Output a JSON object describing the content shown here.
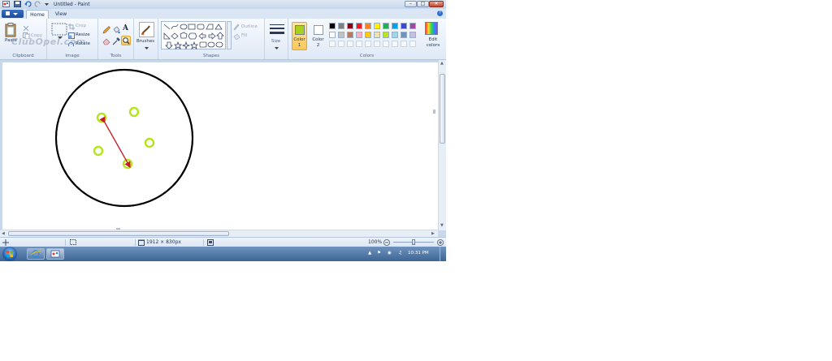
{
  "window": {
    "title": "Untitled - Paint"
  },
  "title_buttons": {
    "minimize": "–",
    "maximize": "□",
    "close": "✕"
  },
  "tabs": {
    "home": "Home",
    "view": "View"
  },
  "help_label": "?",
  "ribbon": {
    "clipboard": {
      "paste": "Paste",
      "copy": "Copy",
      "group": "Clipboard"
    },
    "image": {
      "crop": "Crop",
      "resize": "Resize",
      "rotate": "Rotate",
      "group": "Image"
    },
    "tools": {
      "text_tool": "A",
      "group": "Tools"
    },
    "brushes": {
      "label": "Brushes"
    },
    "shapes": {
      "outline": "Outline",
      "fill": "Fill",
      "group": "Shapes"
    },
    "size": {
      "label": "Size"
    },
    "colors": {
      "color1": "Color 1",
      "color2": "Color 2",
      "edit_colors": "Edit colors",
      "group": "Colors",
      "color1_value": "#a8d01c",
      "color2_value": "#ffffff",
      "palette_row1": [
        "#000000",
        "#7f7f7f",
        "#880015",
        "#ed1c24",
        "#ff7f27",
        "#fff200",
        "#22b14c",
        "#00a2e8",
        "#3f48cc",
        "#a349a4"
      ],
      "palette_row2": [
        "#ffffff",
        "#c3c3c3",
        "#b97a57",
        "#ffaec9",
        "#ffc90e",
        "#efe4b0",
        "#b5e61d",
        "#99d9ea",
        "#7092be",
        "#c8bfe7"
      ]
    }
  },
  "watermark": "ClubOpel.com",
  "status": {
    "dimensions": "1912 × 830px",
    "zoom": "100%"
  },
  "taskbar": {
    "clock": "10:31 PM"
  }
}
